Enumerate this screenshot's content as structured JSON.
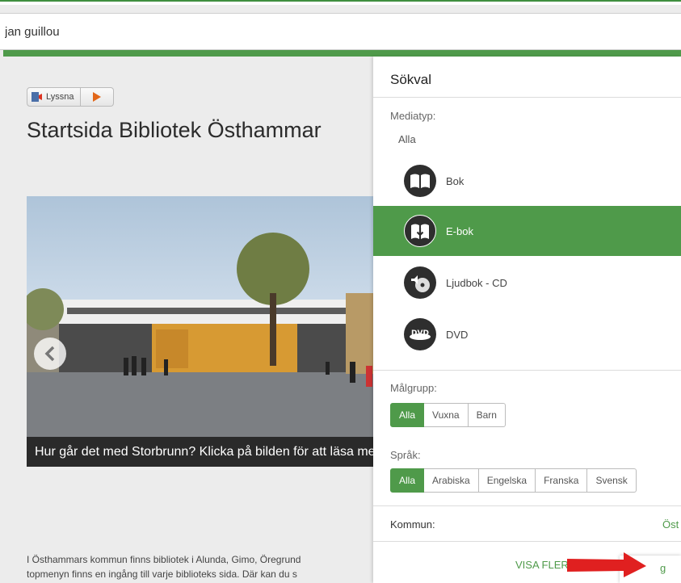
{
  "search": {
    "value": "jan guillou"
  },
  "listen": {
    "label": "Lyssna"
  },
  "main": {
    "title": "Startsida Bibliotek Östhammar",
    "hero_caption": "Hur går det med Storbrunn? Klicka på bilden för att läsa mer",
    "intro_line1": "I Östhammars kommun finns bibliotek i Alunda, Gimo, Öregrund",
    "intro_line2": "topmenyn finns en ingång till varje biblioteks sida. Där kan du s"
  },
  "panel": {
    "title": "Sökval",
    "mediatyp_label": "Mediatyp:",
    "mediatyp_all": "Alla",
    "media_items": [
      {
        "label": "Bok",
        "icon": "book-icon",
        "active": false
      },
      {
        "label": "E-bok",
        "icon": "ebook-icon",
        "active": true
      },
      {
        "label": "Ljudbok - CD",
        "icon": "audiobook-cd-icon",
        "active": false
      },
      {
        "label": "DVD",
        "icon": "dvd-icon",
        "active": false
      }
    ],
    "malgrupp_label": "Målgrupp:",
    "malgrupp_options": [
      "Alla",
      "Vuxna",
      "Barn"
    ],
    "sprak_label": "Språk:",
    "sprak_options": [
      "Alla",
      "Arabiska",
      "Engelska",
      "Franska",
      "Svensk"
    ],
    "kommun_label": "Kommun:",
    "kommun_value": "Öst",
    "visa_fler": "VISA FLER",
    "corner_text": "g"
  },
  "colors": {
    "accent": "#4f9a4a",
    "arrow": "#e02020"
  }
}
